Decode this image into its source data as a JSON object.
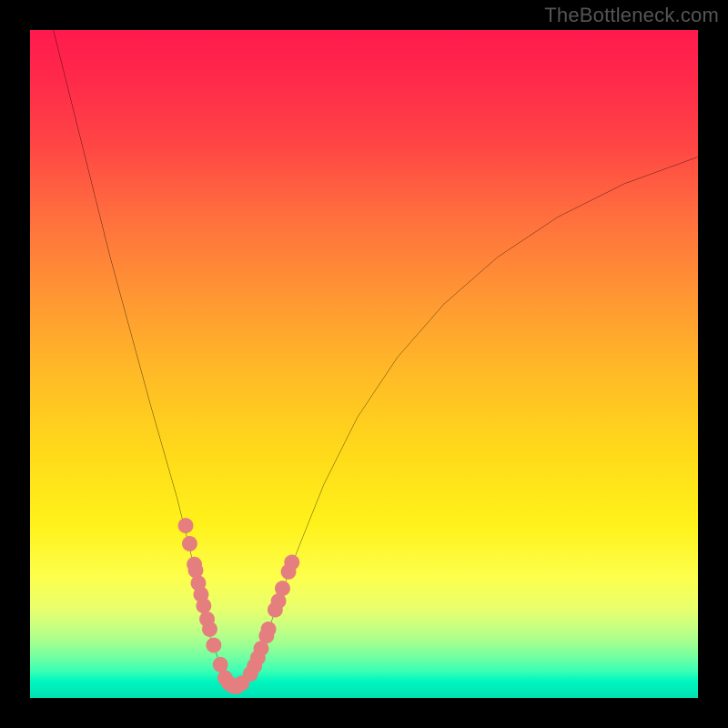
{
  "watermark": "TheBottleneck.com",
  "chart_data": {
    "type": "line",
    "title": "",
    "xlabel": "",
    "ylabel": "",
    "xlim": [
      0,
      100
    ],
    "ylim": [
      0,
      100
    ],
    "series": [
      {
        "name": "bottleneck-curve",
        "color": "#000000",
        "x": [
          3.5,
          6,
          9,
          12,
          15,
          18,
          20,
          22,
          24,
          25.5,
          27,
          28.5,
          29.5,
          30,
          30.6,
          31.5,
          33.4,
          35,
          37,
          40,
          44,
          49,
          55,
          62,
          70,
          79,
          89,
          100
        ],
        "y": [
          100,
          90,
          78,
          66,
          55,
          44,
          37,
          30,
          22,
          15,
          9,
          5,
          2.2,
          1.2,
          1.1,
          1.6,
          4,
          8,
          14,
          22,
          32,
          42,
          51,
          59,
          66,
          72,
          77,
          81
        ]
      },
      {
        "name": "highlight-dots",
        "color": "#e57e7f",
        "type": "scatter",
        "x": [
          23.3,
          23.9,
          24.6,
          24.8,
          25.2,
          25.6,
          26.0,
          26.5,
          26.9,
          27.5,
          28.5,
          29.2,
          29.8,
          30.4,
          30.9,
          31.7,
          33.0,
          33.6,
          34.1,
          34.6,
          35.4,
          35.7,
          36.7,
          37.2,
          37.8,
          38.7,
          39.2
        ],
        "y": [
          25.8,
          23.1,
          20.0,
          19.1,
          17.2,
          15.5,
          13.8,
          11.8,
          10.3,
          7.9,
          5.0,
          3.0,
          2.2,
          1.8,
          1.7,
          2.2,
          3.6,
          4.8,
          6.0,
          7.4,
          9.3,
          10.3,
          13.2,
          14.5,
          16.4,
          18.9,
          20.3
        ]
      }
    ]
  }
}
